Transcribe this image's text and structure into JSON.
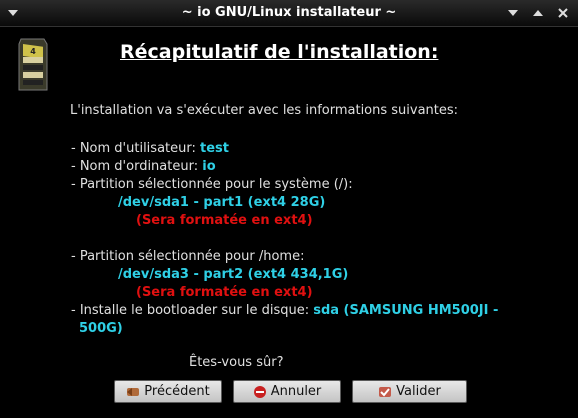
{
  "window": {
    "title": "~ io GNU/Linux installateur ~",
    "titlebar_buttons": [
      "pin",
      "minimize",
      "maximize",
      "close"
    ]
  },
  "content": {
    "heading": "Récapitulatif de l'installation:",
    "intro": "L'installation va s'exécuter avec les informations suivantes:",
    "username_label": " - Nom d'utilisateur: ",
    "username_value": "test",
    "hostname_label": " - Nom d'ordinateur: ",
    "hostname_value": "io",
    "system_partition_label": " - Partition sélectionnée pour le système (/):",
    "system_partition_value": "/dev/sda1 - part1  (ext4 28G)",
    "system_partition_note": "(Sera formatée en ext4)",
    "home_partition_label": " - Partition sélectionnée pour /home:",
    "home_partition_value": "/dev/sda3 - part2  (ext4 434,1G)",
    "home_partition_note": "(Sera formatée en ext4)",
    "bootloader_label": " - Installe le bootloader sur le disque: ",
    "bootloader_value_line1": "sda (SAMSUNG HM500JI -",
    "bootloader_value_line2": "500G)",
    "confirm_question": "Êtes-vous sûr?"
  },
  "buttons": {
    "previous": "Précédent",
    "cancel": "Annuler",
    "validate": "Valider"
  },
  "colors": {
    "background": "#000000",
    "value_text": "#2fd0e6",
    "warning_text": "#e01010",
    "body_text": "#e0e0e0"
  },
  "icons": {
    "app": "installer-box-icon",
    "previous": "back-arrow-icon",
    "cancel": "no-entry-icon",
    "validate": "check-icon"
  }
}
